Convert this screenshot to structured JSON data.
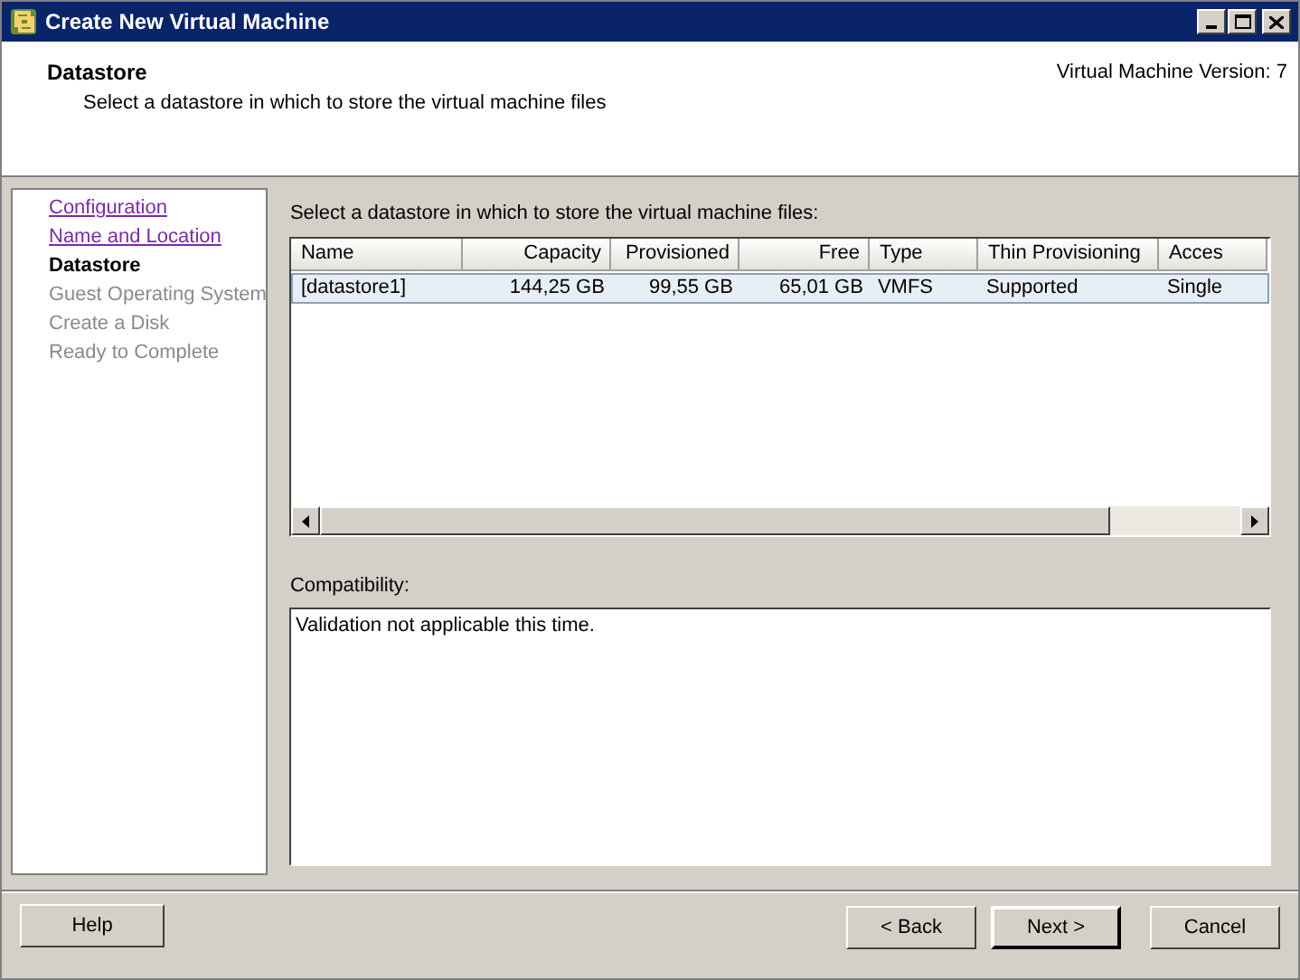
{
  "window": {
    "title": "Create New Virtual Machine"
  },
  "header": {
    "title": "Datastore",
    "subtitle": "Select a datastore in which to store the virtual machine files",
    "version": "Virtual Machine Version: 7"
  },
  "steps": [
    {
      "label": "Configuration",
      "kind": "link"
    },
    {
      "label": "Name and Location",
      "kind": "link"
    },
    {
      "label": "Datastore",
      "kind": "current"
    },
    {
      "label": "Guest Operating System",
      "kind": "disabled"
    },
    {
      "label": "Create a Disk",
      "kind": "disabled"
    },
    {
      "label": "Ready to Complete",
      "kind": "disabled"
    }
  ],
  "instruction": "Select a datastore in which to store the virtual machine files:",
  "table": {
    "columns": [
      {
        "label": "Name",
        "kind": "text"
      },
      {
        "label": "Capacity",
        "kind": "number"
      },
      {
        "label": "Provisioned",
        "kind": "number"
      },
      {
        "label": "Free",
        "kind": "number"
      },
      {
        "label": "Type",
        "kind": "text"
      },
      {
        "label": "Thin Provisioning",
        "kind": "text"
      },
      {
        "label": "Acces",
        "kind": "text"
      }
    ],
    "rows": [
      {
        "cells": [
          "[datastore1]",
          "144,25 GB",
          "99,55 GB",
          "65,01 GB",
          "VMFS",
          "Supported",
          "Single"
        ],
        "selected": true
      }
    ]
  },
  "compatibility": {
    "label": "Compatibility:",
    "text": "Validation not applicable this time."
  },
  "buttons": {
    "help": "Help",
    "back": "< Back",
    "next": "Next >",
    "cancel": "Cancel"
  }
}
